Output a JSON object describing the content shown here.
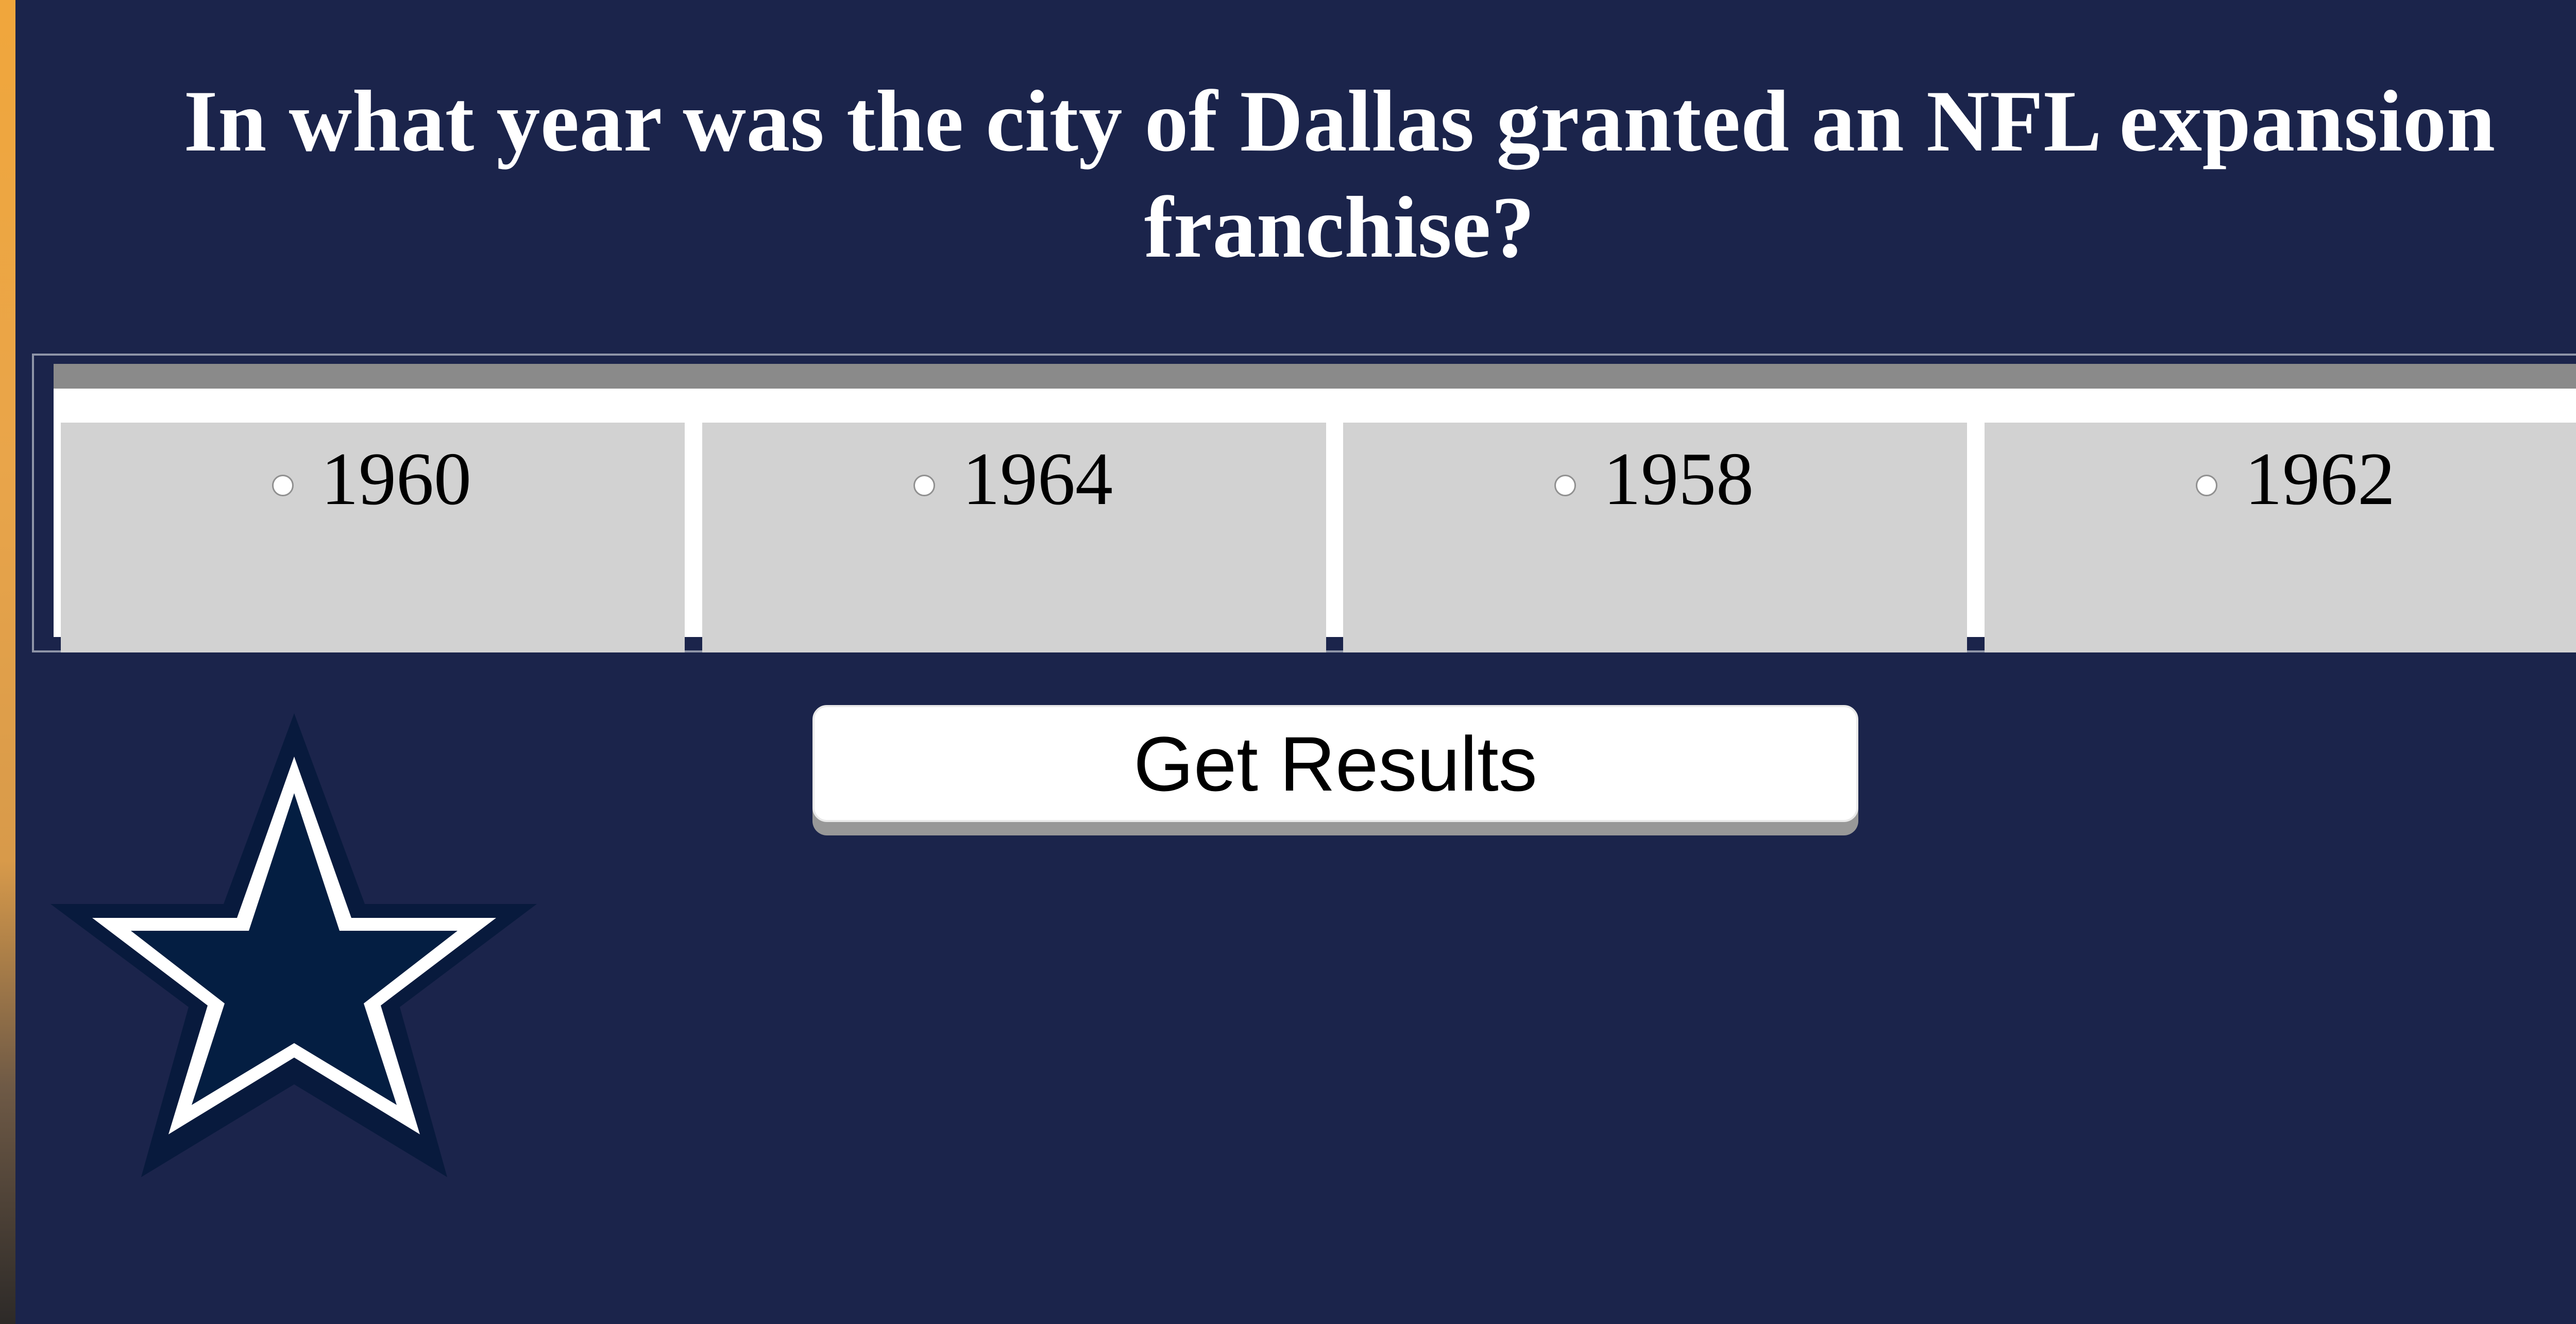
{
  "question": {
    "text": "In what year was the city of Dallas granted an NFL expansion franchise?"
  },
  "answers": [
    {
      "label": "1960",
      "selected": false
    },
    {
      "label": "1964",
      "selected": false
    },
    {
      "label": "1958",
      "selected": false
    },
    {
      "label": "1962",
      "selected": false
    }
  ],
  "submit": {
    "label": "Get Results"
  },
  "logo": {
    "icon": "star-icon",
    "colors": {
      "fill": "#041e42",
      "stroke": "#ffffff",
      "outer": "#081a3d"
    }
  },
  "colors": {
    "background": "#1b244b",
    "question_text": "#ffffff",
    "answer_cell": "#d2d2d2",
    "table_header": "#8a8a8a",
    "button_bg": "#ffffff",
    "button_shadow": "#989898"
  }
}
